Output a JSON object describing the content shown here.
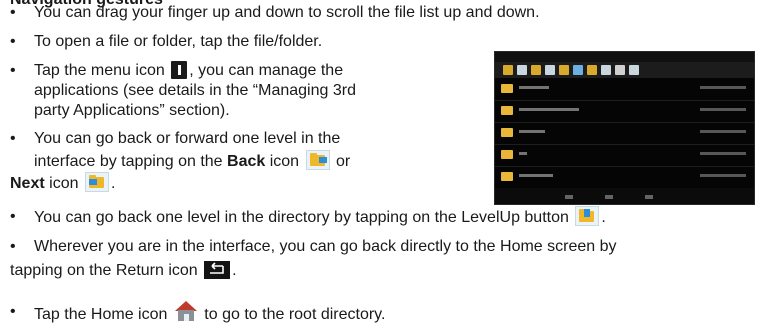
{
  "heading": "Navigation gestures",
  "bullets": [
    {
      "parts": [
        {
          "text": "You can drag your finger up and down to scroll the file list up and down."
        }
      ]
    },
    {
      "parts": [
        {
          "text": "To open a file or folder, tap the file/folder."
        }
      ]
    },
    {
      "lines": [
        "Tap the menu icon ",
        ", you can manage the",
        "applications (see details in the “Managing 3rd",
        "party Applications” section)."
      ]
    },
    {
      "lines": [
        "You can go back or forward one level in the",
        "interface by tapping on the ",
        "Back",
        " icon ",
        " or",
        "Next",
        " icon ",
        "."
      ]
    },
    {
      "parts": [
        {
          "text": "You can go back one level in the directory by tapping on the LevelUp button "
        },
        {
          "text": "."
        }
      ]
    },
    {
      "lines": [
        "Wherever you are in the interface, you can go back directly to the Home screen by",
        "tapping on the Return icon ",
        "."
      ]
    },
    {
      "parts": [
        {
          "text": "Tap the Home icon "
        },
        {
          "text": " to go to the root directory."
        }
      ]
    }
  ],
  "bullet_char": "•",
  "icons": {
    "menu": "menu-icon",
    "back": "back-folder-icon",
    "next": "next-folder-icon",
    "levelup": "levelup-folder-icon",
    "return": "return-icon",
    "home": "home-icon"
  },
  "screenshot": {
    "alt": "File manager screenshot",
    "rows": 5
  }
}
